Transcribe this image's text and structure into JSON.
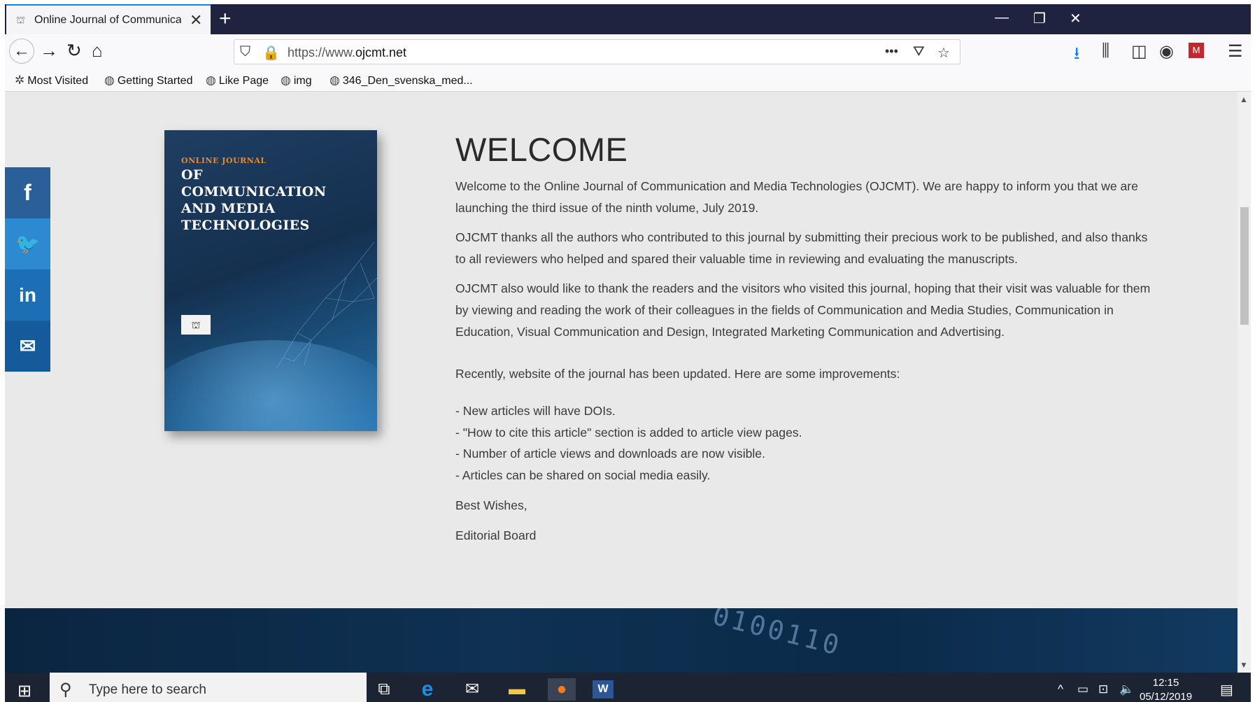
{
  "browser": {
    "tab_title": "Online Journal of Communicat",
    "new_tab_label": "+",
    "url_prefix": "https://www.",
    "url_domain": "ojcmt.net",
    "bookmarks": [
      "Most Visited",
      "Getting Started",
      "Like Page",
      "img",
      "346_Den_svenska_med..."
    ]
  },
  "social": [
    {
      "name": "facebook",
      "glyph": "f",
      "color": "#2b5f9a"
    },
    {
      "name": "twitter",
      "glyph": "🐦",
      "color": "#2e8ad0"
    },
    {
      "name": "linkedin",
      "glyph": "in",
      "color": "#1c6fb4"
    },
    {
      "name": "email",
      "glyph": "✉",
      "color": "#155a9a"
    }
  ],
  "cover": {
    "kicker": "ONLINE JOURNAL",
    "title": "OF COMMUNICATION AND MEDIA TECHNOLOGIES"
  },
  "welcome": {
    "title": "WELCOME",
    "p1": "Welcome to the Online Journal of Communication and Media Technologies (OJCMT). We are happy to inform you that we are launching the third issue of the ninth volume, July 2019.",
    "p2": "OJCMT thanks all the authors who contributed to this journal by submitting their precious work to be published, and also thanks to all reviewers who helped and spared their valuable time in reviewing and evaluating the manuscripts.",
    "p3": "OJCMT also would like to thank the readers and the visitors who visited this journal, hoping that their visit was valuable for them by viewing and reading the work of their colleagues in the fields of Communication and Media Studies, Communication in Education, Visual Communication and Design, Integrated Marketing Communication and Advertising.",
    "p4": "Recently, website of the journal has been updated. Here are some improvements:",
    "improvements": [
      "- New articles will have DOIs.",
      "- \"How to cite this article\" section is added to article view pages.",
      "- Number of article views and downloads are now visible.",
      "- Articles can be shared on social media easily."
    ],
    "closing": "Best Wishes,",
    "signature": "Editorial Board"
  },
  "footer": {
    "binary": "0100110"
  },
  "taskbar": {
    "search_placeholder": "Type here to search",
    "time": "12:15",
    "date": "05/12/2019"
  }
}
